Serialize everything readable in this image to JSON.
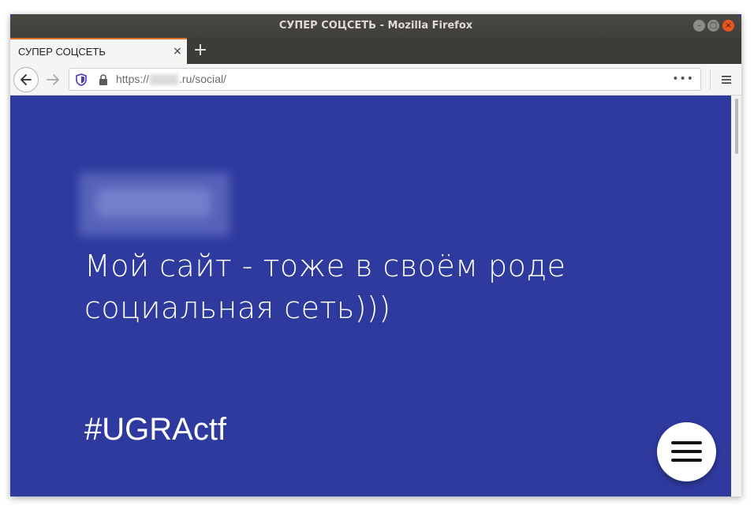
{
  "window": {
    "title": "СУПЕР СОЦСЕТЬ - Mozilla Firefox",
    "minimize_label": "–",
    "maximize_label": "□",
    "close_label": "×"
  },
  "tabs": [
    {
      "label": "СУПЕР СОЦСЕТЬ",
      "close_label": "×",
      "active": true
    }
  ],
  "new_tab_label": "+",
  "navbar": {
    "url_prefix": "https://",
    "url_domain_suffix": ".ru",
    "url_path": "/social/",
    "more_label": "•••"
  },
  "icons": {
    "back": "arrow-left-icon",
    "forward": "arrow-right-icon",
    "tracking": "shield-icon",
    "secure": "lock-icon",
    "menu": "hamburger-icon"
  },
  "page": {
    "headline_line1": "Мой сайт - тоже в своём роде",
    "headline_line2": "социальная сеть)))",
    "hashtag": "#UGRActf",
    "background_color": "#2f3a9f"
  },
  "colors": {
    "tab_accent": "#e8732a",
    "close_button": "#e9541f",
    "page_background": "#2f3a9f"
  }
}
